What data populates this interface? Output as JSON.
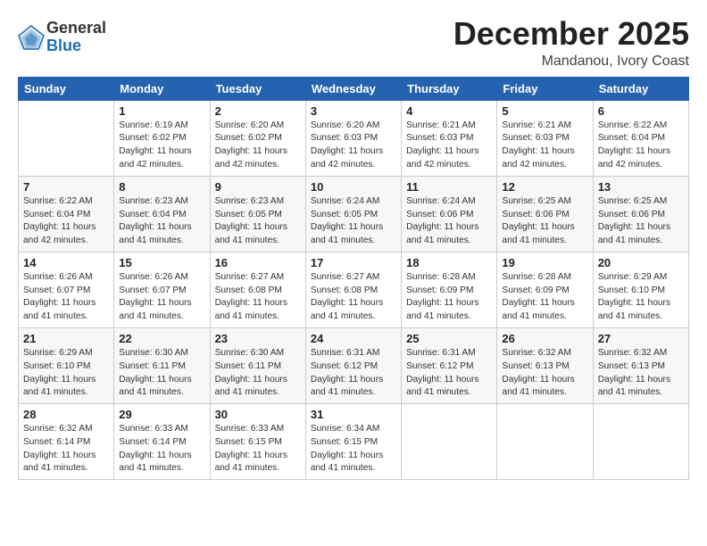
{
  "logo": {
    "general": "General",
    "blue": "Blue"
  },
  "title": "December 2025",
  "subtitle": "Mandanou, Ivory Coast",
  "days_of_week": [
    "Sunday",
    "Monday",
    "Tuesday",
    "Wednesday",
    "Thursday",
    "Friday",
    "Saturday"
  ],
  "weeks": [
    [
      {
        "day": "",
        "info": ""
      },
      {
        "day": "1",
        "info": "Sunrise: 6:19 AM\nSunset: 6:02 PM\nDaylight: 11 hours\nand 42 minutes."
      },
      {
        "day": "2",
        "info": "Sunrise: 6:20 AM\nSunset: 6:02 PM\nDaylight: 11 hours\nand 42 minutes."
      },
      {
        "day": "3",
        "info": "Sunrise: 6:20 AM\nSunset: 6:03 PM\nDaylight: 11 hours\nand 42 minutes."
      },
      {
        "day": "4",
        "info": "Sunrise: 6:21 AM\nSunset: 6:03 PM\nDaylight: 11 hours\nand 42 minutes."
      },
      {
        "day": "5",
        "info": "Sunrise: 6:21 AM\nSunset: 6:03 PM\nDaylight: 11 hours\nand 42 minutes."
      },
      {
        "day": "6",
        "info": "Sunrise: 6:22 AM\nSunset: 6:04 PM\nDaylight: 11 hours\nand 42 minutes."
      }
    ],
    [
      {
        "day": "7",
        "info": "Sunrise: 6:22 AM\nSunset: 6:04 PM\nDaylight: 11 hours\nand 42 minutes."
      },
      {
        "day": "8",
        "info": "Sunrise: 6:23 AM\nSunset: 6:04 PM\nDaylight: 11 hours\nand 41 minutes."
      },
      {
        "day": "9",
        "info": "Sunrise: 6:23 AM\nSunset: 6:05 PM\nDaylight: 11 hours\nand 41 minutes."
      },
      {
        "day": "10",
        "info": "Sunrise: 6:24 AM\nSunset: 6:05 PM\nDaylight: 11 hours\nand 41 minutes."
      },
      {
        "day": "11",
        "info": "Sunrise: 6:24 AM\nSunset: 6:06 PM\nDaylight: 11 hours\nand 41 minutes."
      },
      {
        "day": "12",
        "info": "Sunrise: 6:25 AM\nSunset: 6:06 PM\nDaylight: 11 hours\nand 41 minutes."
      },
      {
        "day": "13",
        "info": "Sunrise: 6:25 AM\nSunset: 6:06 PM\nDaylight: 11 hours\nand 41 minutes."
      }
    ],
    [
      {
        "day": "14",
        "info": "Sunrise: 6:26 AM\nSunset: 6:07 PM\nDaylight: 11 hours\nand 41 minutes."
      },
      {
        "day": "15",
        "info": "Sunrise: 6:26 AM\nSunset: 6:07 PM\nDaylight: 11 hours\nand 41 minutes."
      },
      {
        "day": "16",
        "info": "Sunrise: 6:27 AM\nSunset: 6:08 PM\nDaylight: 11 hours\nand 41 minutes."
      },
      {
        "day": "17",
        "info": "Sunrise: 6:27 AM\nSunset: 6:08 PM\nDaylight: 11 hours\nand 41 minutes."
      },
      {
        "day": "18",
        "info": "Sunrise: 6:28 AM\nSunset: 6:09 PM\nDaylight: 11 hours\nand 41 minutes."
      },
      {
        "day": "19",
        "info": "Sunrise: 6:28 AM\nSunset: 6:09 PM\nDaylight: 11 hours\nand 41 minutes."
      },
      {
        "day": "20",
        "info": "Sunrise: 6:29 AM\nSunset: 6:10 PM\nDaylight: 11 hours\nand 41 minutes."
      }
    ],
    [
      {
        "day": "21",
        "info": "Sunrise: 6:29 AM\nSunset: 6:10 PM\nDaylight: 11 hours\nand 41 minutes."
      },
      {
        "day": "22",
        "info": "Sunrise: 6:30 AM\nSunset: 6:11 PM\nDaylight: 11 hours\nand 41 minutes."
      },
      {
        "day": "23",
        "info": "Sunrise: 6:30 AM\nSunset: 6:11 PM\nDaylight: 11 hours\nand 41 minutes."
      },
      {
        "day": "24",
        "info": "Sunrise: 6:31 AM\nSunset: 6:12 PM\nDaylight: 11 hours\nand 41 minutes."
      },
      {
        "day": "25",
        "info": "Sunrise: 6:31 AM\nSunset: 6:12 PM\nDaylight: 11 hours\nand 41 minutes."
      },
      {
        "day": "26",
        "info": "Sunrise: 6:32 AM\nSunset: 6:13 PM\nDaylight: 11 hours\nand 41 minutes."
      },
      {
        "day": "27",
        "info": "Sunrise: 6:32 AM\nSunset: 6:13 PM\nDaylight: 11 hours\nand 41 minutes."
      }
    ],
    [
      {
        "day": "28",
        "info": "Sunrise: 6:32 AM\nSunset: 6:14 PM\nDaylight: 11 hours\nand 41 minutes."
      },
      {
        "day": "29",
        "info": "Sunrise: 6:33 AM\nSunset: 6:14 PM\nDaylight: 11 hours\nand 41 minutes."
      },
      {
        "day": "30",
        "info": "Sunrise: 6:33 AM\nSunset: 6:15 PM\nDaylight: 11 hours\nand 41 minutes."
      },
      {
        "day": "31",
        "info": "Sunrise: 6:34 AM\nSunset: 6:15 PM\nDaylight: 11 hours\nand 41 minutes."
      },
      {
        "day": "",
        "info": ""
      },
      {
        "day": "",
        "info": ""
      },
      {
        "day": "",
        "info": ""
      }
    ]
  ]
}
